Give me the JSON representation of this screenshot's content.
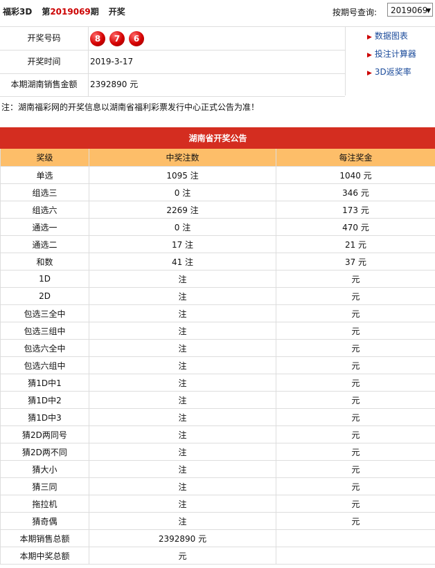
{
  "header": {
    "title_prefix": "福彩3D",
    "title_di": "第",
    "issue": "2019069",
    "title_qi": "期",
    "title_suffix": "开奖",
    "query_label": "按期号查询:",
    "query_value": "2019069"
  },
  "info": {
    "draw_numbers_label": "开奖号码",
    "balls": [
      "8",
      "7",
      "6"
    ],
    "draw_time_label": "开奖时间",
    "draw_time": "2019-3-17",
    "sales_label": "本期湖南销售金额",
    "sales_value": "2392890 元"
  },
  "links": [
    "数据图表",
    "投注计算器",
    "3D返奖率"
  ],
  "notice": "注：湖南福彩网的开奖信息以湖南省福利彩票发行中心正式公告为准！",
  "table": {
    "caption": "湖南省开奖公告",
    "columns": [
      "奖级",
      "中奖注数",
      "每注奖金"
    ],
    "rows": [
      [
        "单选",
        "1095 注",
        "1040 元"
      ],
      [
        "组选三",
        "0 注",
        "346 元"
      ],
      [
        "组选六",
        "2269 注",
        "173 元"
      ],
      [
        "通选一",
        "0 注",
        "470 元"
      ],
      [
        "通选二",
        "17 注",
        "21 元"
      ],
      [
        "和数",
        "41 注",
        "37 元"
      ],
      [
        "1D",
        "注",
        "元"
      ],
      [
        "2D",
        "注",
        "元"
      ],
      [
        "包选三全中",
        "注",
        "元"
      ],
      [
        "包选三组中",
        "注",
        "元"
      ],
      [
        "包选六全中",
        "注",
        "元"
      ],
      [
        "包选六组中",
        "注",
        "元"
      ],
      [
        "猜1D中1",
        "注",
        "元"
      ],
      [
        "猜1D中2",
        "注",
        "元"
      ],
      [
        "猜1D中3",
        "注",
        "元"
      ],
      [
        "猜2D两同号",
        "注",
        "元"
      ],
      [
        "猜2D两不同",
        "注",
        "元"
      ],
      [
        "猜大小",
        "注",
        "元"
      ],
      [
        "猜三同",
        "注",
        "元"
      ],
      [
        "拖拉机",
        "注",
        "元"
      ],
      [
        "猜奇偶",
        "注",
        "元"
      ]
    ],
    "total_sales_label": "本期销售总额",
    "total_sales_value": "2392890 元",
    "total_prize_label": "本期中奖总额",
    "total_prize_value": "元"
  }
}
